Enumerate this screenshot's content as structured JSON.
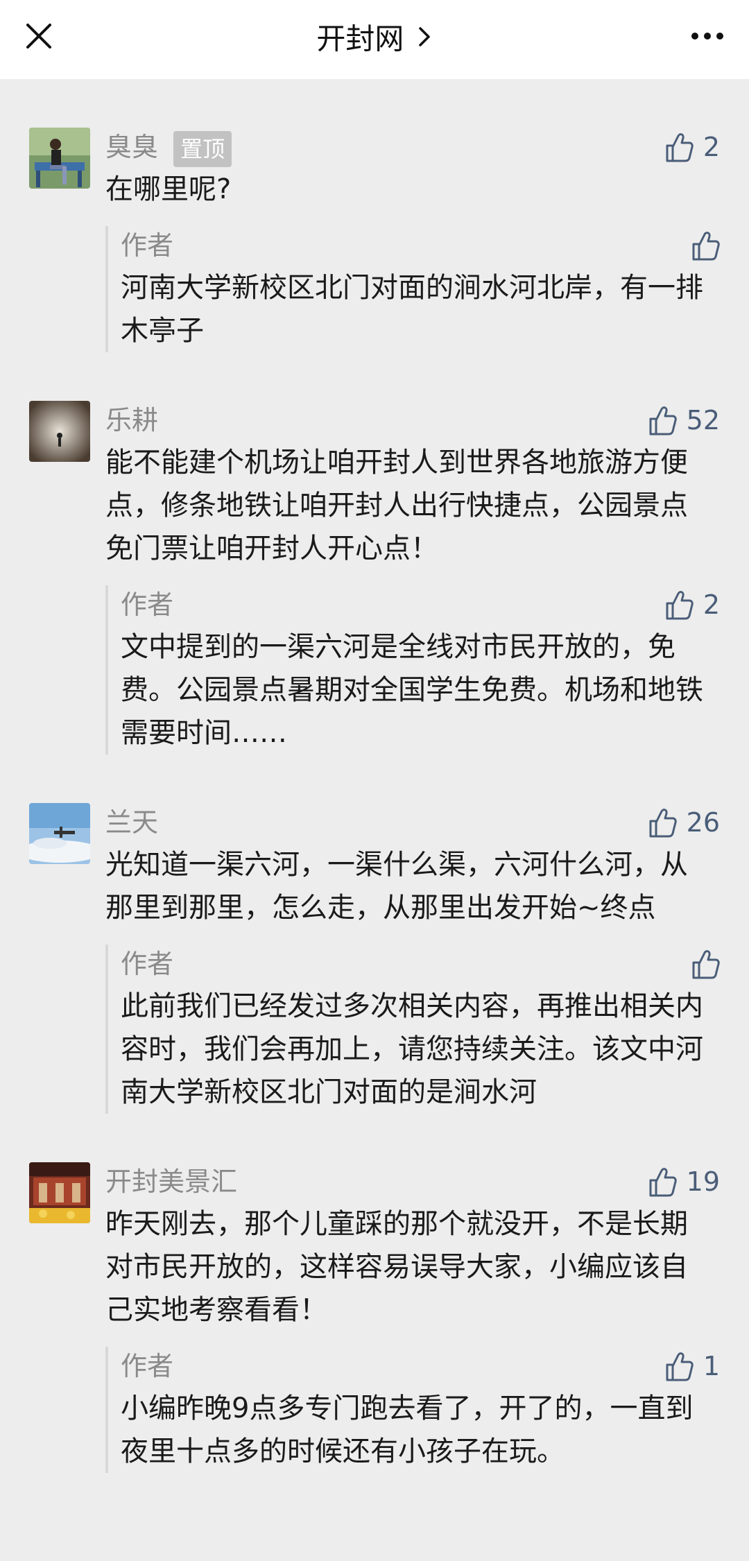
{
  "header": {
    "title": "开封网",
    "close_icon": "close-icon",
    "chevron_icon": "chevron-right-icon",
    "more_icon": "more-icon"
  },
  "comments": [
    {
      "nickname": "臭臭",
      "pinned_label": "置顶",
      "likes": "2",
      "text": "在哪里呢?",
      "reply": {
        "author": "作者",
        "likes": "",
        "text": "河南大学新校区北门对面的涧水河北岸，有一排木亭子"
      }
    },
    {
      "nickname": "乐耕",
      "likes": "52",
      "text": "能不能建个机场让咱开封人到世界各地旅游方便点，修条地铁让咱开封人出行快捷点，公园景点免门票让咱开封人开心点！",
      "reply": {
        "author": "作者",
        "likes": "2",
        "text": "文中提到的一渠六河是全线对市民开放的，免费。公园景点暑期对全国学生免费。机场和地铁需要时间……"
      }
    },
    {
      "nickname": "兰天",
      "likes": "26",
      "text": "光知道一渠六河，一渠什么渠，六河什么河，从那里到那里，怎么走，从那里出发开始~终点",
      "reply": {
        "author": "作者",
        "likes": "",
        "text": "此前我们已经发过多次相关内容，再推出相关内容时，我们会再加上，请您持续关注。该文中河南大学新校区北门对面的是涧水河"
      }
    },
    {
      "nickname": "开封美景汇",
      "likes": "19",
      "text": "昨天刚去，那个儿童踩的那个就没开，不是长期对市民开放的，这样容易误导大家，小编应该自己实地考察看看！",
      "reply": {
        "author": "作者",
        "likes": "1",
        "text": "小编昨晚9点多专门跑去看了，开了的，一直到夜里十点多的时候还有小孩子在玩。"
      }
    }
  ],
  "colors": {
    "background": "#ededed",
    "header_bg": "#ffffff",
    "nickname": "#8a8a8a",
    "like_icon": "#4a5d78",
    "pin_badge_bg": "#c2c2c2"
  }
}
